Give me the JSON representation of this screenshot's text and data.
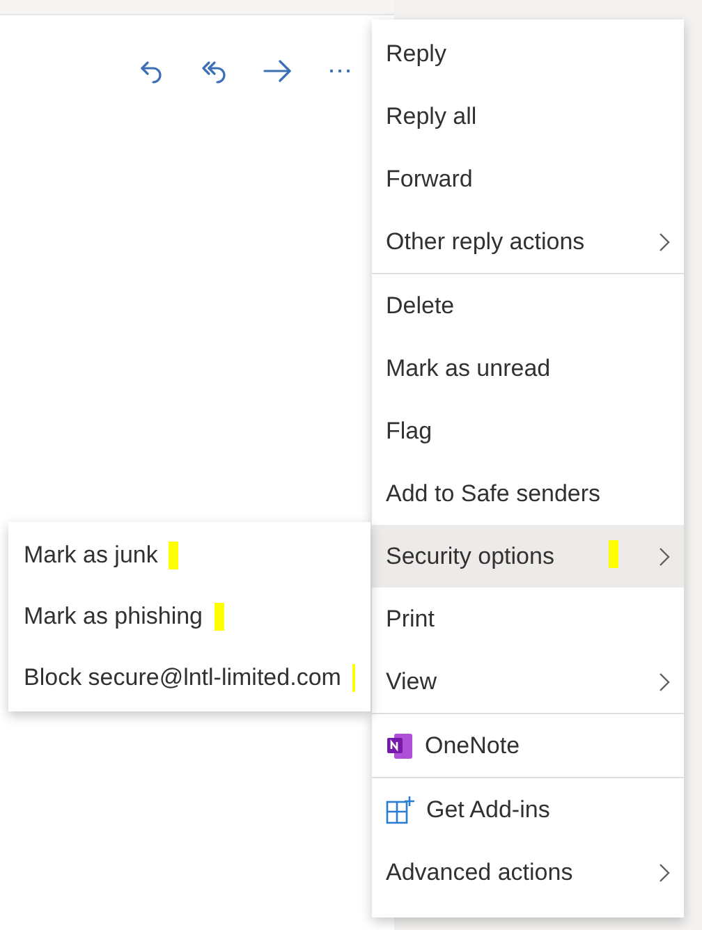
{
  "toolbar": [
    {
      "kind": "reply"
    },
    {
      "kind": "reply_all"
    },
    {
      "kind": "forward"
    },
    {
      "kind": "more",
      "label": "⋯"
    }
  ],
  "menu": {
    "sections": [
      {
        "items": [
          {
            "label": "Reply",
            "submenu": false,
            "selected": false,
            "marked": false
          },
          {
            "label": "Reply all",
            "submenu": false,
            "selected": false,
            "marked": false
          },
          {
            "label": "Forward",
            "submenu": false,
            "selected": false,
            "marked": false
          },
          {
            "label": "Other reply actions",
            "submenu": true,
            "selected": false,
            "marked": false
          }
        ]
      },
      {
        "items": [
          {
            "label": "Delete",
            "submenu": false,
            "selected": false,
            "marked": false
          },
          {
            "label": "Mark as unread",
            "submenu": false,
            "selected": false,
            "marked": false
          },
          {
            "label": "Flag",
            "submenu": false,
            "selected": false,
            "marked": false
          },
          {
            "label": "Add to Safe senders",
            "submenu": false,
            "selected": false,
            "marked": false
          },
          {
            "label": "Security options",
            "submenu": true,
            "selected": true,
            "marked": true
          },
          {
            "label": "Print",
            "submenu": false,
            "selected": false,
            "marked": false
          },
          {
            "label": "View",
            "submenu": true,
            "selected": false,
            "marked": false
          }
        ]
      },
      {
        "items": [
          {
            "label": "OneNote",
            "submenu": false,
            "selected": false,
            "marked": false,
            "kind": "onenote"
          }
        ]
      },
      {
        "items": [
          {
            "label": "Get Add-ins",
            "submenu": false,
            "selected": false,
            "marked": false,
            "kind": "addins"
          },
          {
            "label": "Advanced actions",
            "submenu": true,
            "selected": false,
            "marked": false
          }
        ]
      }
    ]
  },
  "submenu": {
    "items": [
      {
        "label": "Mark as junk",
        "marked": true
      },
      {
        "label": "Mark as phishing",
        "marked": true
      },
      {
        "label": "Block secure@lntl-limited.com",
        "marked": true
      }
    ]
  }
}
